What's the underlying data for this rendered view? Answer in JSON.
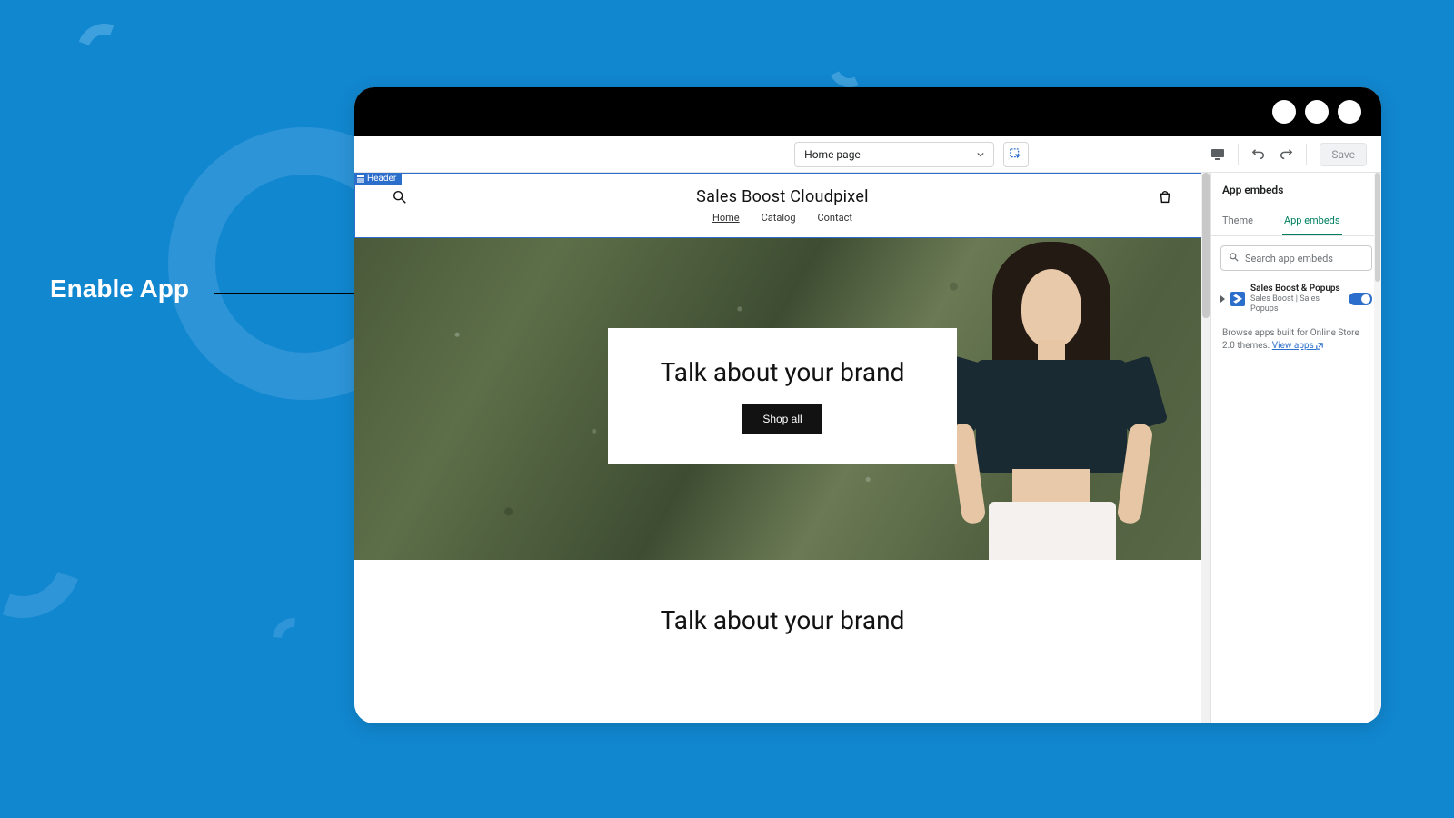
{
  "annotation": {
    "label": "Enable App"
  },
  "topbar": {
    "page_selector": "Home page",
    "save": "Save"
  },
  "preview": {
    "header_tag": "Header",
    "store_title": "Sales Boost Cloudpixel",
    "nav": {
      "home": "Home",
      "catalog": "Catalog",
      "contact": "Contact"
    },
    "hero_heading": "Talk about your brand",
    "hero_cta": "Shop all",
    "section_heading": "Talk about your brand"
  },
  "sidebar": {
    "title": "App embeds",
    "tabs": {
      "theme": "Theme",
      "embeds": "App embeds"
    },
    "search_placeholder": "Search app embeds",
    "embed": {
      "name": "Sales Boost & Popups",
      "subtitle": "Sales Boost | Sales Popups"
    },
    "browse_text": "Browse apps built for Online Store 2.0 themes.",
    "view_apps": "View apps"
  }
}
